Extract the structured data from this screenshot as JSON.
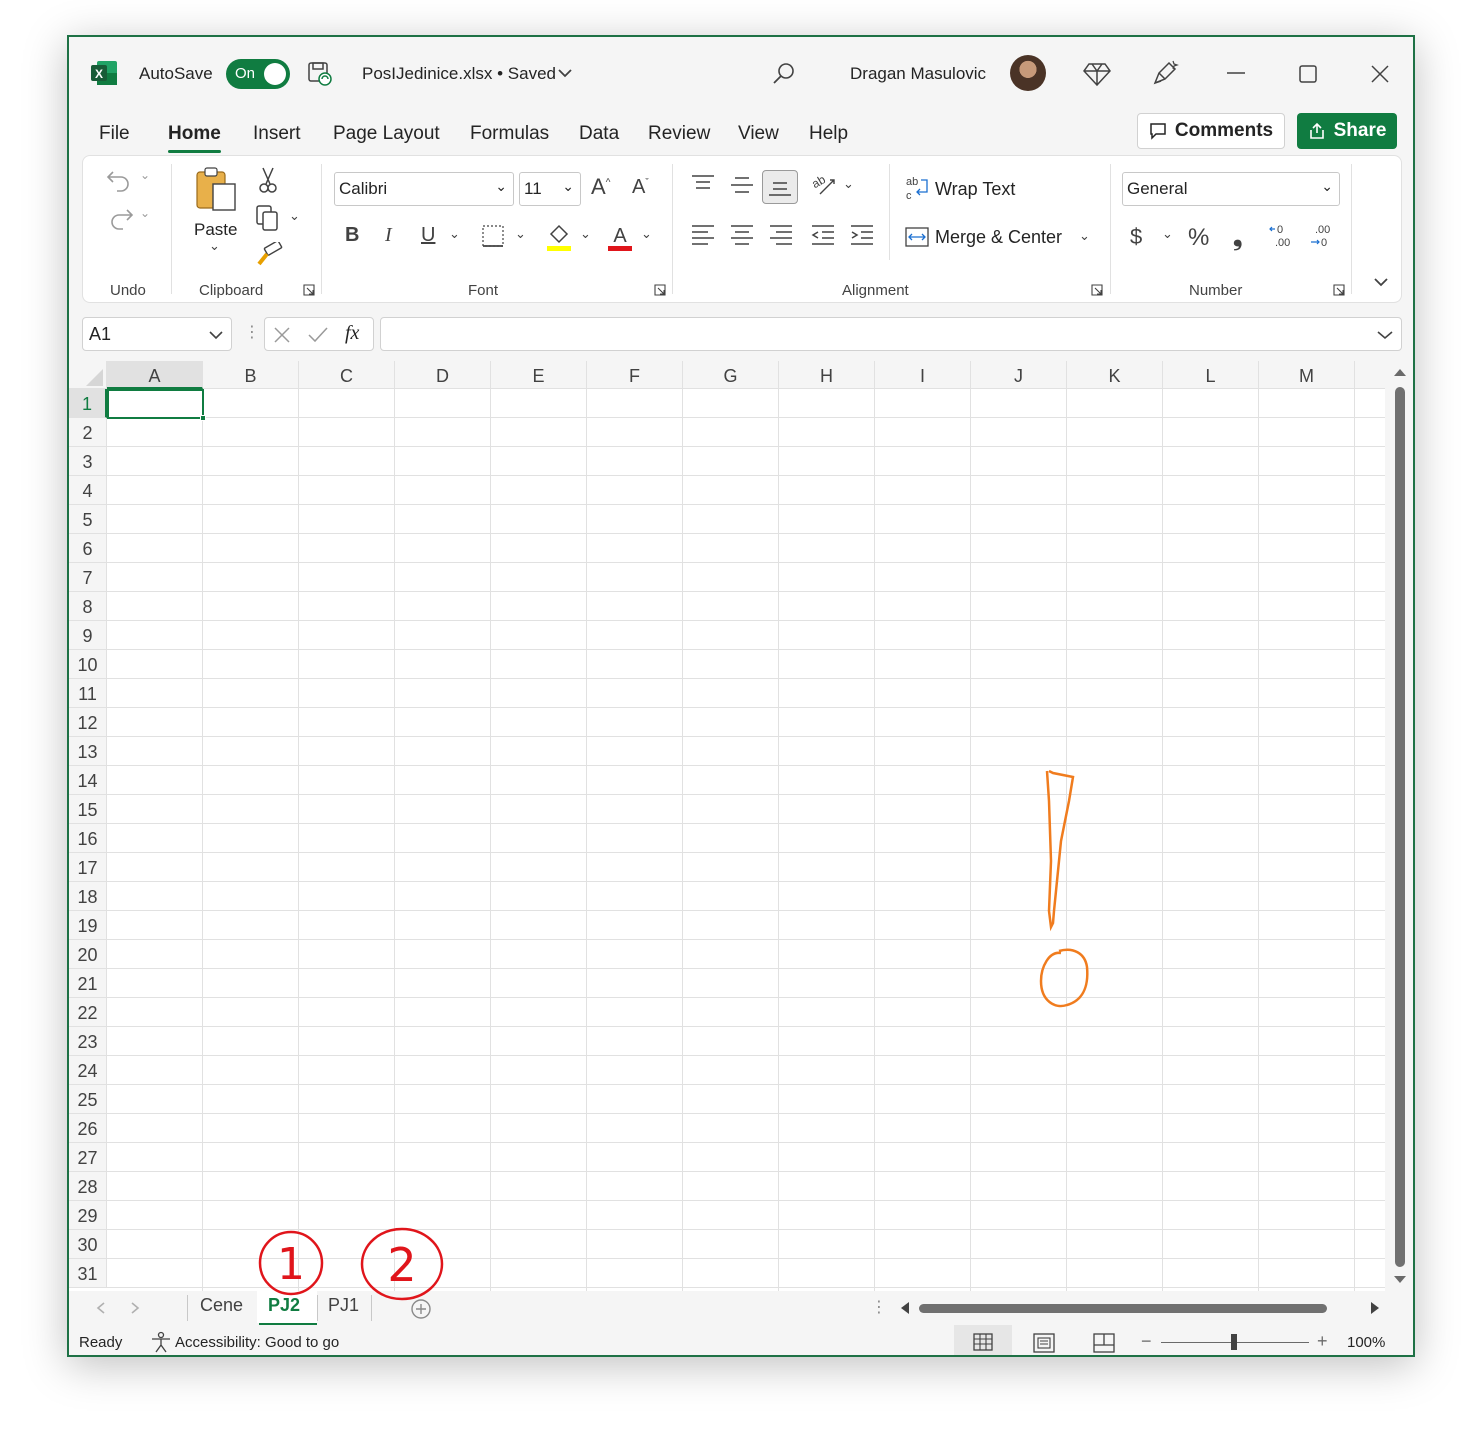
{
  "titlebar": {
    "autosave_label": "AutoSave",
    "autosave_state": "On",
    "filename": "PosIJedinice.xlsx • Saved",
    "user_name": "Dragan Masulovic"
  },
  "menu": {
    "items": [
      "File",
      "Home",
      "Insert",
      "Page Layout",
      "Formulas",
      "Data",
      "Review",
      "View",
      "Help"
    ],
    "active": "Home",
    "comments_label": "Comments",
    "share_label": "Share"
  },
  "ribbon": {
    "undo_group": "Undo",
    "clipboard_group": "Clipboard",
    "paste_label": "Paste",
    "font_group": "Font",
    "font_name": "Calibri",
    "font_size": "11",
    "bold": "B",
    "italic": "I",
    "underline": "U",
    "alignment_group": "Alignment",
    "wrap_text": "Wrap Text",
    "merge_center": "Merge & Center",
    "number_group": "Number",
    "number_format": "General",
    "currency": "$",
    "percent": "%",
    "comma": "❟",
    "increase_decimal": "←0 .00",
    "decrease_decimal": ".00 →0"
  },
  "formula_bar": {
    "name_box": "A1",
    "fx": "fx",
    "value": ""
  },
  "grid": {
    "columns": [
      "A",
      "B",
      "C",
      "D",
      "E",
      "F",
      "G",
      "H",
      "I",
      "J",
      "K",
      "L",
      "M"
    ],
    "rows": [
      "1",
      "2",
      "3",
      "4",
      "5",
      "6",
      "7",
      "8",
      "9",
      "10",
      "11",
      "12",
      "13",
      "14",
      "15",
      "16",
      "17",
      "18",
      "19",
      "20",
      "21",
      "22",
      "23",
      "24",
      "25",
      "26",
      "27",
      "28",
      "29",
      "30",
      "31"
    ],
    "selected_cell": "A1"
  },
  "sheets": {
    "tabs": [
      "Cene",
      "PJ2",
      "PJ1"
    ],
    "active": "PJ2"
  },
  "annotations": {
    "circle_1": "1",
    "circle_2": "2",
    "exclamation_color": "#f07c1e",
    "circles_color": "#e0151b"
  },
  "status": {
    "ready": "Ready",
    "accessibility": "Accessibility: Good to go",
    "zoom": "100%",
    "zoom_minus": "−",
    "zoom_plus": "+"
  },
  "colors": {
    "accent": "#107c41",
    "font_color_bar": "#e0151b",
    "highlight_bar": "#ffff00"
  }
}
